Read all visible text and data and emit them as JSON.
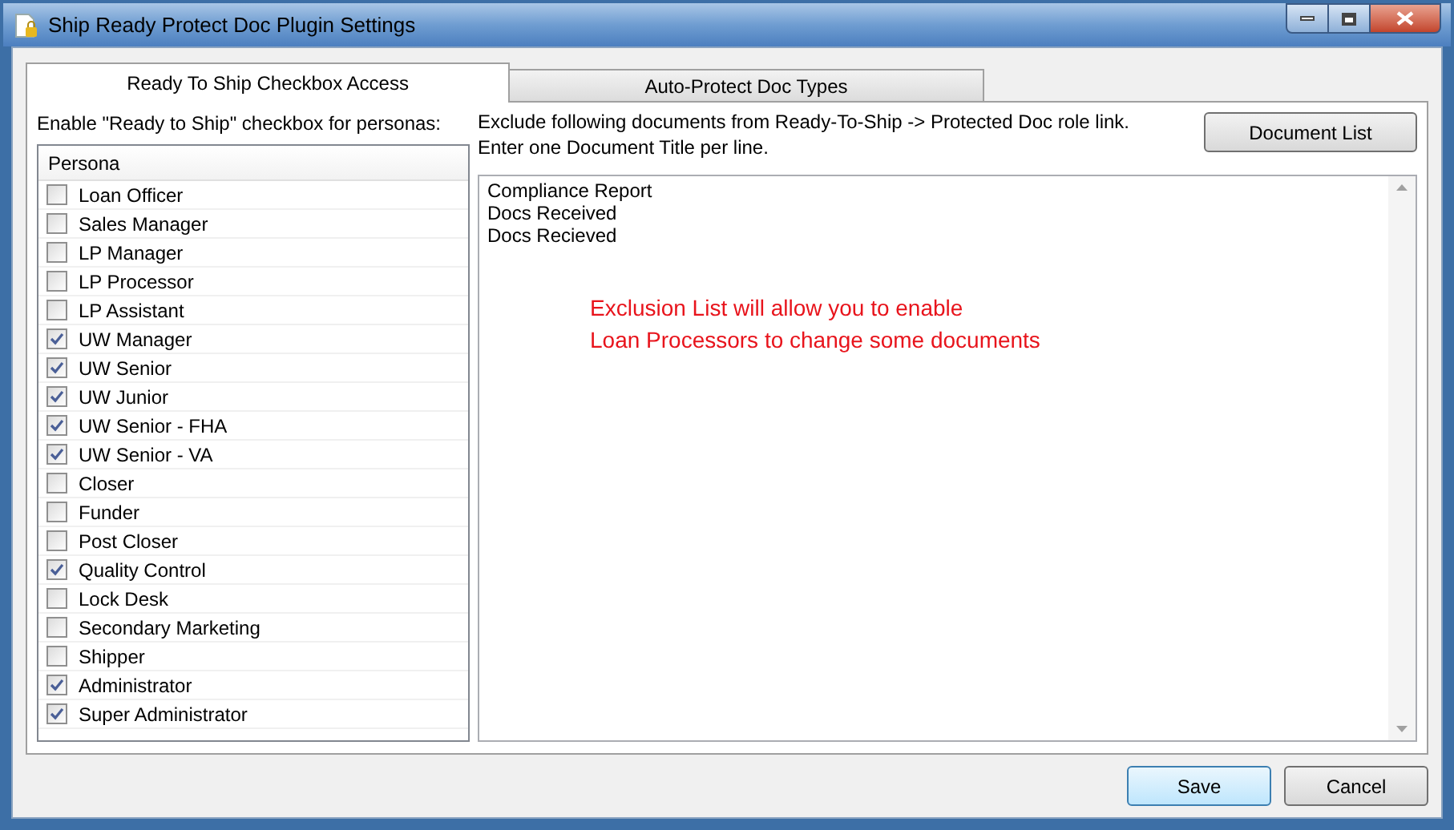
{
  "window": {
    "title": "Ship Ready Protect Doc Plugin Settings"
  },
  "tabs": [
    {
      "label": "Ready To Ship Checkbox Access",
      "selected": true
    },
    {
      "label": "Auto-Protect Doc Types",
      "selected": false
    }
  ],
  "left": {
    "caption": "Enable \"Ready to Ship\" checkbox for personas:",
    "column": "Persona",
    "personas": [
      {
        "name": "Loan Officer",
        "checked": false
      },
      {
        "name": "Sales Manager",
        "checked": false
      },
      {
        "name": "LP Manager",
        "checked": false
      },
      {
        "name": "LP Processor",
        "checked": false
      },
      {
        "name": "LP Assistant",
        "checked": false
      },
      {
        "name": "UW Manager",
        "checked": true
      },
      {
        "name": "UW Senior",
        "checked": true
      },
      {
        "name": "UW Junior",
        "checked": true
      },
      {
        "name": "UW Senior - FHA",
        "checked": true
      },
      {
        "name": "UW Senior - VA",
        "checked": true
      },
      {
        "name": "Closer",
        "checked": false
      },
      {
        "name": "Funder",
        "checked": false
      },
      {
        "name": "Post Closer",
        "checked": false
      },
      {
        "name": "Quality Control",
        "checked": true
      },
      {
        "name": "Lock Desk",
        "checked": false
      },
      {
        "name": "Secondary Marketing",
        "checked": false
      },
      {
        "name": "Shipper",
        "checked": false
      },
      {
        "name": "Administrator",
        "checked": true
      },
      {
        "name": "Super Administrator",
        "checked": true
      }
    ]
  },
  "right": {
    "instructions": [
      "Exclude following documents from Ready-To-Ship -> Protected Doc role link.",
      "Enter one Document Title per line."
    ],
    "document_list_button": "Document List",
    "documents": [
      "Compliance Report",
      "Docs Received",
      "Docs Recieved"
    ],
    "note": [
      "Exclusion List will allow you to enable",
      "Loan Processors to change some documents"
    ]
  },
  "buttons": [
    {
      "label": "Save",
      "kind": "default"
    },
    {
      "label": "Cancel",
      "kind": "normal"
    }
  ]
}
